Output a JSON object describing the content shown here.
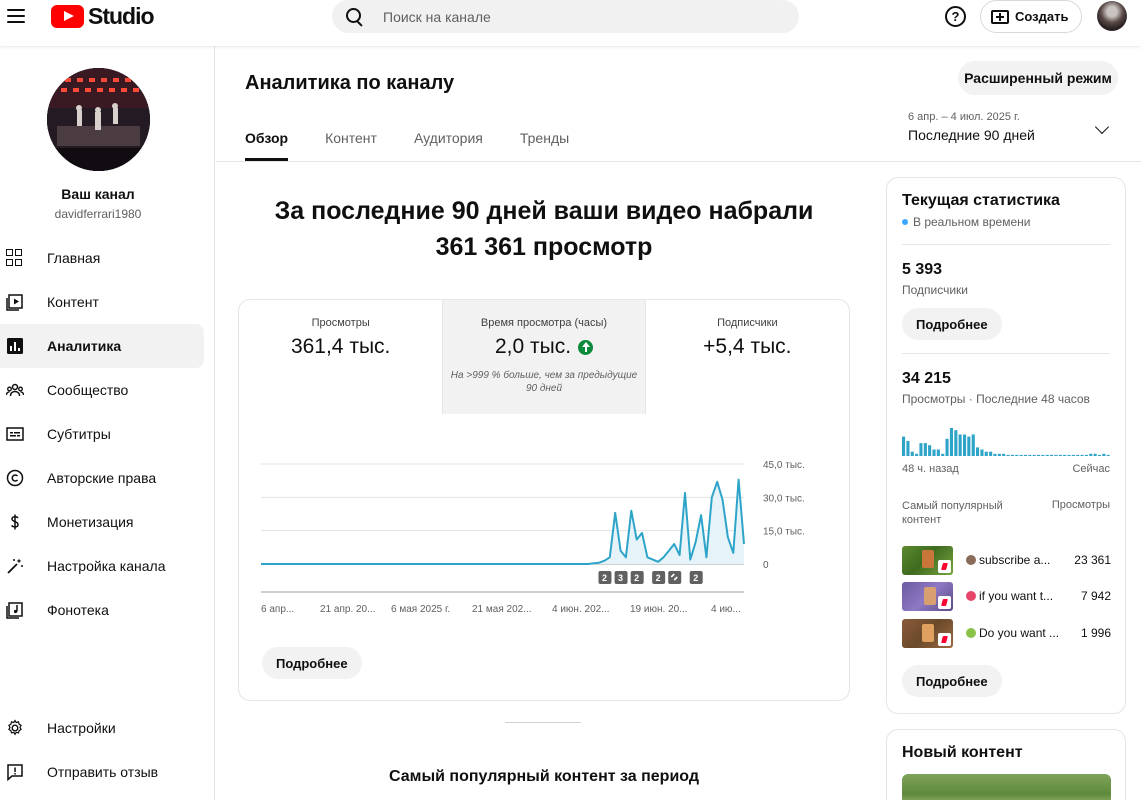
{
  "header": {
    "logo_text": "Studio",
    "search_placeholder": "Поиск на канале",
    "help_label": "?",
    "create_label": "Создать"
  },
  "sidebar": {
    "channel_name": "Ваш канал",
    "channel_handle": "davidferrari1980",
    "items": [
      {
        "label": "Главная",
        "icon": "dashboard-icon"
      },
      {
        "label": "Контент",
        "icon": "content-icon"
      },
      {
        "label": "Аналитика",
        "icon": "analytics-icon",
        "active": true
      },
      {
        "label": "Сообщество",
        "icon": "community-icon"
      },
      {
        "label": "Субтитры",
        "icon": "subtitles-icon"
      },
      {
        "label": "Авторские права",
        "icon": "copyright-icon"
      },
      {
        "label": "Монетизация",
        "icon": "monetization-icon"
      },
      {
        "label": "Настройка канала",
        "icon": "customization-icon"
      },
      {
        "label": "Фонотека",
        "icon": "audio-library-icon"
      }
    ],
    "bottom_items": [
      {
        "label": "Настройки",
        "icon": "settings-icon"
      },
      {
        "label": "Отправить отзыв",
        "icon": "feedback-icon"
      }
    ]
  },
  "main": {
    "title": "Аналитика по каналу",
    "advanced_mode_label": "Расширенный режим",
    "tabs": [
      {
        "label": "Обзор",
        "active": true
      },
      {
        "label": "Контент"
      },
      {
        "label": "Аудитория"
      },
      {
        "label": "Тренды"
      }
    ],
    "date_range_small": "6 апр. – 4 июл. 2025 г.",
    "date_range_label": "Последние 90 дней",
    "headline_line1": "За последние 90 дней ваши видео набрали",
    "headline_line2": "361 361 просмотр",
    "metrics": [
      {
        "label": "Просмотры",
        "value": "361,4 тыс."
      },
      {
        "label": "Время просмотра (часы)",
        "value": "2,0 тыс.",
        "note": "На >999 % больше, чем за предыдущие 90 дней",
        "trend": "up"
      },
      {
        "label": "Подписчики",
        "value": "+5,4 тыс."
      }
    ],
    "more_label": "Подробнее",
    "top_content_title": "Самый популярный контент за период"
  },
  "chart_data": {
    "type": "area",
    "x_tick_labels": [
      "6 апр...",
      "21 апр. 20...",
      "6 мая 2025 г.",
      "21 мая 202...",
      "4 июн. 202...",
      "19 июн. 20...",
      "4 ию..."
    ],
    "y_tick_labels": [
      "45,0 тыс.",
      "30,0 тыс.",
      "15,0 тыс.",
      "0"
    ],
    "ylim": [
      0,
      45000
    ],
    "grid": true,
    "x_days": [
      0,
      1,
      2,
      3,
      4,
      5,
      6,
      7,
      8,
      9,
      10,
      11,
      12,
      13,
      14,
      15,
      16,
      17,
      18,
      19,
      20,
      21,
      22,
      23,
      24,
      25,
      26,
      27,
      28,
      29,
      30,
      31,
      32,
      33,
      34,
      35,
      36,
      37,
      38,
      39,
      40,
      41,
      42,
      43,
      44,
      45,
      46,
      47,
      48,
      49,
      50,
      51,
      52,
      53,
      54,
      55,
      56,
      57,
      58,
      59,
      60,
      61,
      62,
      63,
      64,
      65,
      66,
      67,
      68,
      69,
      70,
      71,
      72,
      73,
      74,
      75,
      76,
      77,
      78,
      79,
      80,
      81,
      82,
      83,
      84,
      85,
      86,
      87,
      88,
      89
    ],
    "values": [
      0,
      0,
      0,
      0,
      0,
      0,
      0,
      0,
      0,
      0,
      0,
      0,
      0,
      0,
      0,
      0,
      0,
      0,
      0,
      0,
      0,
      0,
      0,
      0,
      0,
      0,
      0,
      0,
      0,
      0,
      0,
      0,
      0,
      0,
      0,
      0,
      0,
      0,
      0,
      0,
      0,
      0,
      0,
      0,
      0,
      0,
      0,
      0,
      0,
      0,
      0,
      0,
      0,
      0,
      0,
      0,
      0,
      0,
      0,
      0,
      0,
      0,
      300,
      600,
      1500,
      3000,
      23000,
      6000,
      3000,
      24000,
      11000,
      14000,
      3000,
      2000,
      1000,
      3000,
      6000,
      9000,
      4000,
      32000,
      2000,
      10000,
      22000,
      3000,
      30000,
      37000,
      29000,
      12000,
      5000,
      38000,
      9000
    ],
    "markers": [
      {
        "label": "2",
        "x_day": 64
      },
      {
        "label": "3",
        "x_day": 67
      },
      {
        "label": "2",
        "x_day": 70
      },
      {
        "label": "2",
        "x_day": 74
      },
      {
        "label": "link",
        "x_day": 77
      },
      {
        "label": "2",
        "x_day": 81
      }
    ],
    "color": "#2ea4c9"
  },
  "realtime": {
    "title": "Текущая статистика",
    "subtitle": "В реальном времени",
    "subscribers_value": "5 393",
    "subscribers_label": "Подписчики",
    "more_label": "Подробнее",
    "views_value": "34 215",
    "views_label": "Просмотры · Последние 48 часов",
    "axis_left": "48 ч. назад",
    "axis_right": "Сейчас",
    "top_content_label": "Самый популярный контент",
    "views_header": "Просмотры",
    "bars": [
      9,
      7,
      2,
      1,
      6,
      6,
      5,
      3,
      3,
      1,
      8,
      13,
      12,
      10,
      10,
      9,
      10,
      4,
      3,
      2,
      2,
      1,
      1,
      1,
      0.5,
      0.5,
      0.5,
      0.5,
      0.5,
      0.5,
      0.5,
      0.5,
      0.5,
      0.5,
      0.5,
      0.5,
      0.5,
      0.5,
      0.5,
      0.5,
      0.5,
      0.5,
      0.5,
      1,
      1,
      0.5,
      1,
      0.5
    ],
    "videos": [
      {
        "title": "subscribe a...",
        "views": "23 361"
      },
      {
        "title": "if you want t...",
        "views": "7 942"
      },
      {
        "title": "Do you want ...",
        "views": "1 996"
      }
    ],
    "more_label2": "Подробнее"
  },
  "new_content": {
    "title": "Новый контент"
  },
  "colors": {
    "accent": "#2ea4c9",
    "brand_red": "#ff0000",
    "positive": "#0a8a3a",
    "realtime_dot": "#3ea6ff"
  }
}
